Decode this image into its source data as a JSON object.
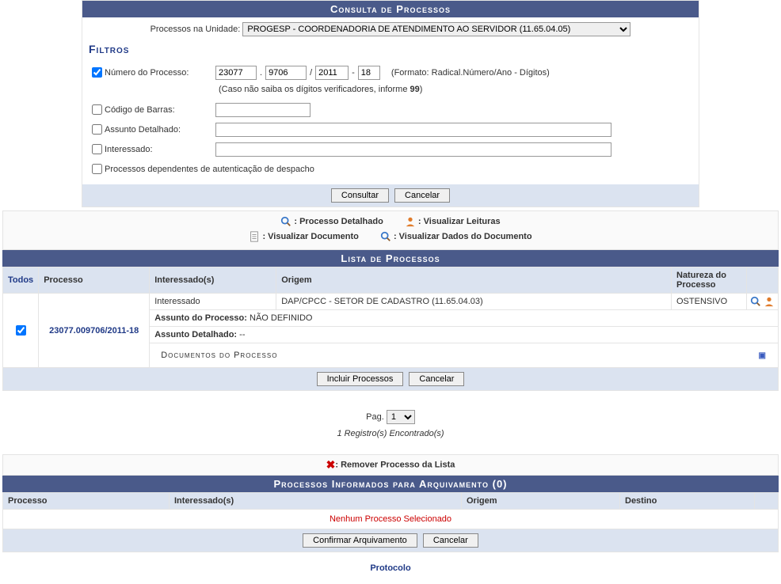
{
  "header": {
    "title": "Consulta de Processos"
  },
  "unit": {
    "label": "Processos na Unidade:",
    "selected": "PROGESP - COORDENADORIA DE ATENDIMENTO AO SERVIDOR (11.65.04.05)"
  },
  "filters": {
    "title": "Filtros",
    "numero_processo": {
      "label": "Número do Processo:",
      "checked": true,
      "radical": "23077",
      "numero": "9706",
      "ano": "2011",
      "digitos": "18",
      "formato": "(Formato: Radical.Número/Ano - Dígitos)",
      "hint_pre": "(Caso não saiba os dígitos verificadores, informe ",
      "hint_bold": "99",
      "hint_post": ")"
    },
    "codigo_barras": {
      "label": "Código de Barras:",
      "value": ""
    },
    "assunto_detalhado": {
      "label": "Assunto Detalhado:",
      "value": ""
    },
    "interessado": {
      "label": "Interessado:",
      "value": ""
    },
    "dependentes": {
      "label": "Processos dependentes de autenticação de despacho"
    }
  },
  "buttons": {
    "consultar": "Consultar",
    "cancelar": "Cancelar",
    "incluir": "Incluir Processos",
    "confirmar": "Confirmar Arquivamento"
  },
  "legend": {
    "processo_detalhado": ": Processo Detalhado",
    "visualizar_leituras": ": Visualizar Leituras",
    "visualizar_documento": ": Visualizar Documento",
    "visualizar_dados_documento": ": Visualizar Dados do Documento",
    "remover": ": Remover Processo da Lista"
  },
  "lista": {
    "title": "Lista de Processos",
    "columns": {
      "todos": "Todos",
      "processo": "Processo",
      "interessados": "Interessado(s)",
      "origem": "Origem",
      "natureza": "Natureza do Processo"
    },
    "row": {
      "checked": true,
      "processo": "23077.009706/2011-18",
      "interessado": "Interessado",
      "origem": "DAP/CPCC - SETOR DE CADASTRO (11.65.04.03)",
      "natureza": "OSTENSIVO",
      "assunto_processo_label": "Assunto do Processo:",
      "assunto_processo_value": "NÃO DEFINIDO",
      "assunto_detalhado_label": "Assunto Detalhado:",
      "assunto_detalhado_value": "--",
      "documentos_title": "Documentos do Processo"
    }
  },
  "pager": {
    "label": "Pag.",
    "selected": "1",
    "found": "1 Registro(s) Encontrado(s)"
  },
  "arquivamento": {
    "title": "Processos Informados para Arquivamento (0)",
    "columns": {
      "processo": "Processo",
      "interessados": "Interessado(s)",
      "origem": "Origem",
      "destino": "Destino"
    },
    "none": "Nenhum Processo Selecionado"
  },
  "footer": {
    "protocolo": "Protocolo"
  }
}
